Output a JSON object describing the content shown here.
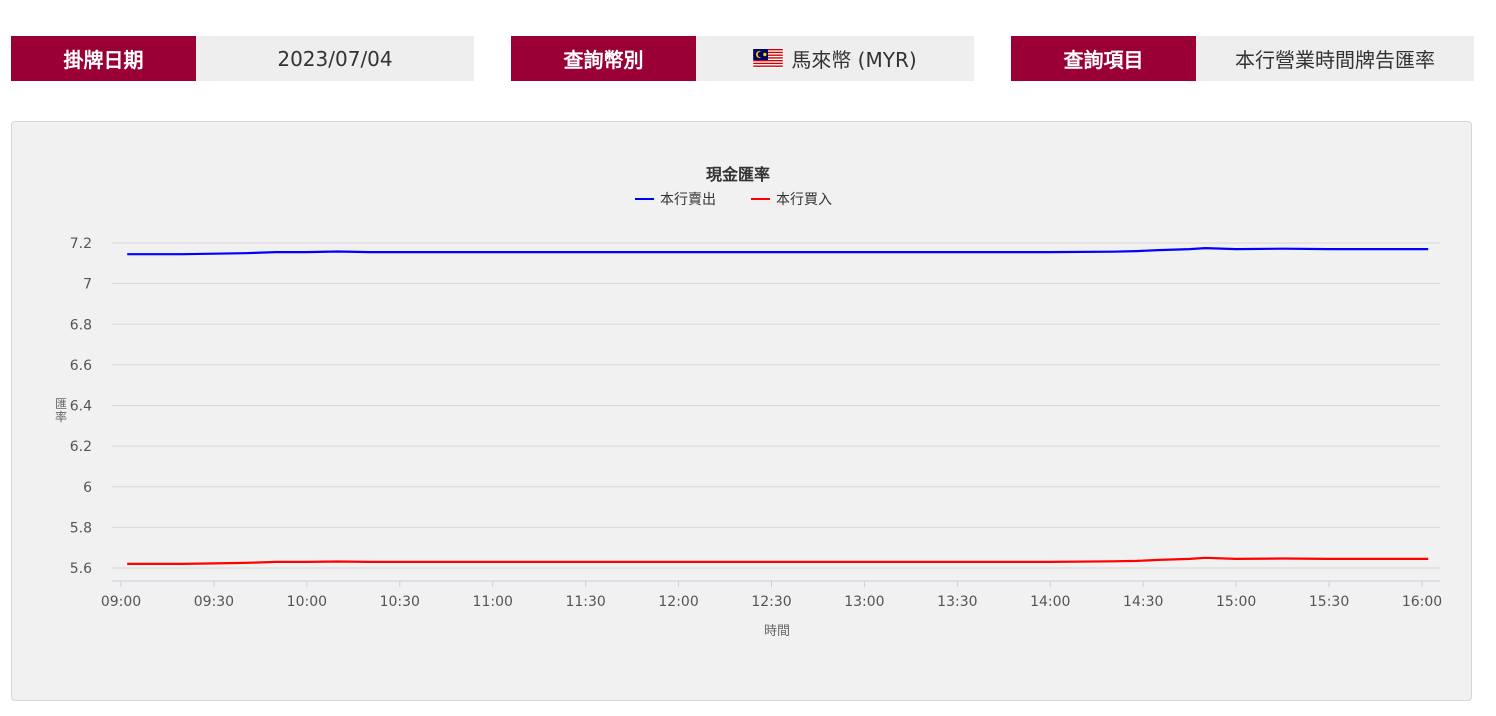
{
  "filters": [
    {
      "label": "掛牌日期",
      "value": "2023/07/04"
    },
    {
      "label": "查詢幣別",
      "value": "馬來幣 (MYR)",
      "flag_icon": "malaysia-flag-icon"
    },
    {
      "label": "查詢項目",
      "value": "本行營業時間牌告匯率"
    }
  ],
  "colors": {
    "brand": "#9a0036",
    "sell": "#0000ff",
    "buy": "#ff0000"
  },
  "chart_data": {
    "type": "line",
    "title": "現金匯率",
    "xlabel": "時間",
    "ylabel": "匯率",
    "x_ticks": [
      "09:00",
      "09:30",
      "10:00",
      "10:30",
      "11:00",
      "11:30",
      "12:00",
      "12:30",
      "13:00",
      "13:30",
      "14:00",
      "14:30",
      "15:00",
      "15:30",
      "16:00"
    ],
    "y_ticks": [
      "5.6",
      "5.8",
      "6",
      "6.2",
      "6.4",
      "6.6",
      "6.8",
      "7",
      "7.2"
    ],
    "ylim": [
      5.55,
      7.2
    ],
    "xlim": [
      "09:00",
      "16:00"
    ],
    "grid": true,
    "legend_position": "top-center",
    "series": [
      {
        "name": "本行賣出",
        "color": "#0000ff",
        "points": [
          [
            "09:02",
            7.145
          ],
          [
            "09:20",
            7.145
          ],
          [
            "09:40",
            7.15
          ],
          [
            "09:50",
            7.155
          ],
          [
            "10:00",
            7.155
          ],
          [
            "10:10",
            7.158
          ],
          [
            "10:20",
            7.155
          ],
          [
            "10:40",
            7.155
          ],
          [
            "11:00",
            7.155
          ],
          [
            "11:30",
            7.155
          ],
          [
            "12:00",
            7.155
          ],
          [
            "13:00",
            7.155
          ],
          [
            "14:00",
            7.155
          ],
          [
            "14:20",
            7.157
          ],
          [
            "14:28",
            7.16
          ],
          [
            "14:35",
            7.165
          ],
          [
            "14:45",
            7.17
          ],
          [
            "14:50",
            7.175
          ],
          [
            "15:00",
            7.17
          ],
          [
            "15:15",
            7.172
          ],
          [
            "15:30",
            7.17
          ],
          [
            "15:45",
            7.17
          ],
          [
            "16:02",
            7.17
          ]
        ]
      },
      {
        "name": "本行買入",
        "color": "#ff0000",
        "points": [
          [
            "09:02",
            5.62
          ],
          [
            "09:20",
            5.62
          ],
          [
            "09:40",
            5.625
          ],
          [
            "09:50",
            5.63
          ],
          [
            "10:00",
            5.63
          ],
          [
            "10:10",
            5.632
          ],
          [
            "10:20",
            5.63
          ],
          [
            "10:40",
            5.63
          ],
          [
            "11:00",
            5.63
          ],
          [
            "11:30",
            5.63
          ],
          [
            "12:00",
            5.63
          ],
          [
            "13:00",
            5.63
          ],
          [
            "14:00",
            5.63
          ],
          [
            "14:20",
            5.633
          ],
          [
            "14:28",
            5.635
          ],
          [
            "14:35",
            5.64
          ],
          [
            "14:45",
            5.645
          ],
          [
            "14:50",
            5.65
          ],
          [
            "15:00",
            5.645
          ],
          [
            "15:15",
            5.647
          ],
          [
            "15:30",
            5.645
          ],
          [
            "15:45",
            5.645
          ],
          [
            "16:02",
            5.645
          ]
        ]
      }
    ]
  }
}
